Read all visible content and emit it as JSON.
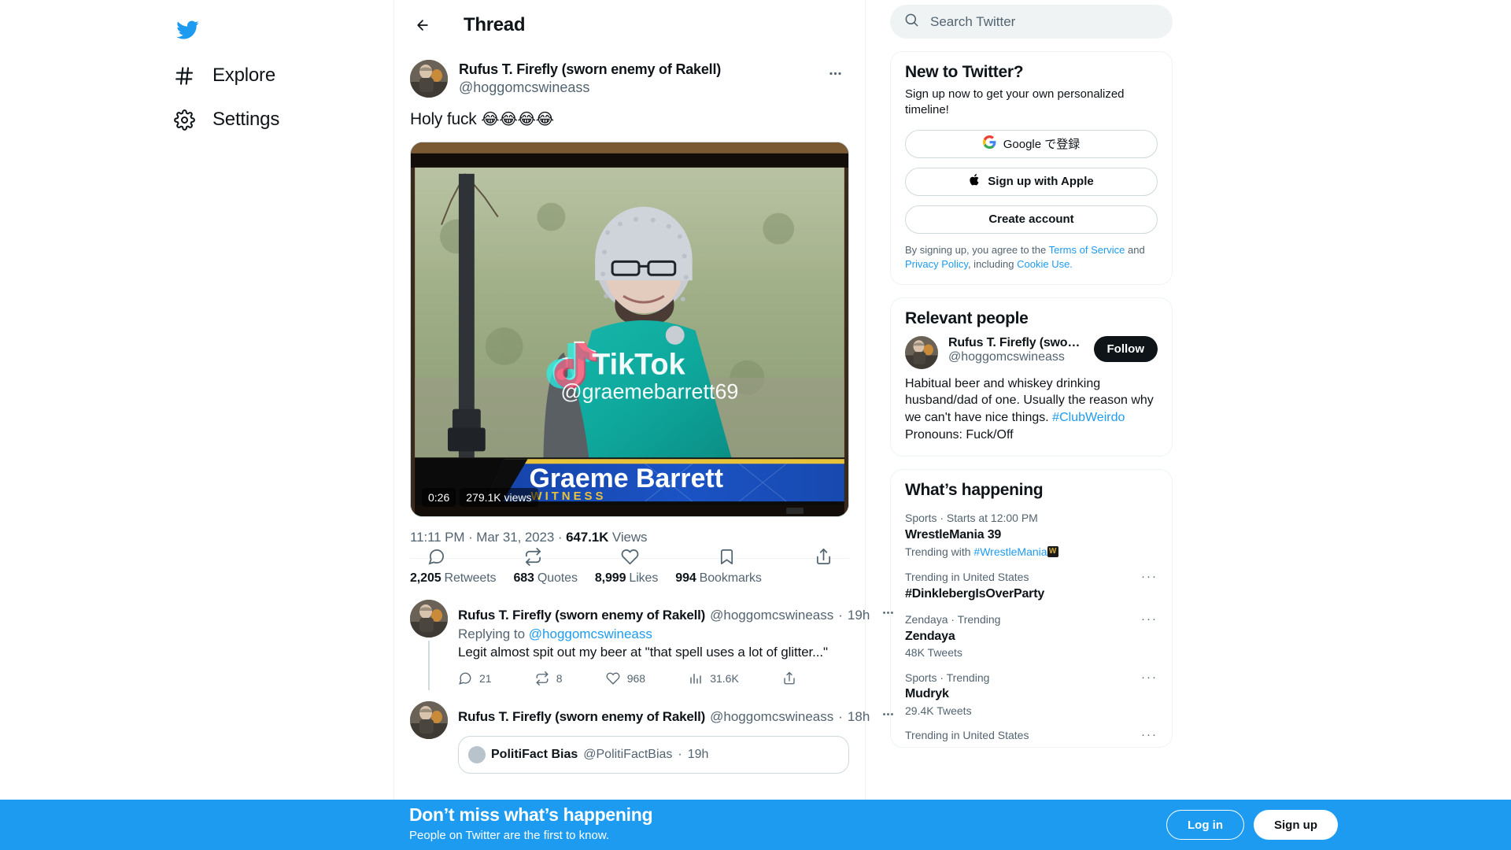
{
  "nav": {
    "logo_icon": "twitter-bird-logo",
    "items": [
      {
        "label": "Explore",
        "icon": "hashtag-icon"
      },
      {
        "label": "Settings",
        "icon": "gear-icon"
      }
    ]
  },
  "header": {
    "title": "Thread",
    "back_icon": "back-arrow-icon"
  },
  "tweet": {
    "author_name": "Rufus T. Firefly (sworn enemy of Rakell)",
    "author_handle": "@hoggomcswineass",
    "more_icon": "more-options-icon",
    "text": "Holy fuck ",
    "emojis": "😂😂😂😂",
    "media": {
      "type": "video",
      "duration": "0:26",
      "views_badge": "279.1K views",
      "watermark_app": "TikTok",
      "watermark_handle": "@graemebarrett69",
      "chyron_name": "Graeme Barrett",
      "chyron_role": "WITNESS"
    },
    "timestamp": "11:11 PM",
    "date": "Mar 31, 2023",
    "views_count": "647.1K",
    "views_label": "Views",
    "counts": [
      {
        "value": "2,205",
        "label": "Retweets"
      },
      {
        "value": "683",
        "label": "Quotes"
      },
      {
        "value": "8,999",
        "label": "Likes"
      },
      {
        "value": "994",
        "label": "Bookmarks"
      }
    ],
    "actions": [
      {
        "icon": "reply-icon"
      },
      {
        "icon": "retweet-icon"
      },
      {
        "icon": "like-heart-icon"
      },
      {
        "icon": "bookmark-icon"
      },
      {
        "icon": "share-icon"
      }
    ]
  },
  "replies": [
    {
      "name": "Rufus T. Firefly (sworn enemy of Rakell)",
      "handle": "@hoggomcswineass",
      "separator": "·",
      "age": "19h",
      "replying_to_label": "Replying to ",
      "replying_to_handle": "@hoggomcswineass",
      "text": "Legit almost spit out my beer at \"that spell uses a lot of glitter...\"",
      "actions": [
        {
          "icon": "reply-icon",
          "count": "21"
        },
        {
          "icon": "retweet-icon",
          "count": "8"
        },
        {
          "icon": "like-heart-icon",
          "count": "968"
        },
        {
          "icon": "views-bars-icon",
          "count": "31.6K"
        },
        {
          "icon": "share-icon",
          "count": ""
        }
      ]
    },
    {
      "name": "Rufus T. Firefly (sworn enemy of Rakell)",
      "handle": "@hoggomcswineass",
      "separator": "·",
      "age": "18h",
      "quote": {
        "name": "PolitiFact Bias",
        "handle": "@PolitiFactBias",
        "separator": "·",
        "age": "19h"
      }
    }
  ],
  "search": {
    "placeholder": "Search Twitter",
    "icon": "search-icon",
    "value": ""
  },
  "signup_card": {
    "title": "New to Twitter?",
    "subtitle": "Sign up now to get your own personalized timeline!",
    "google_label": "Google で登録",
    "google_icon": "google-g-icon",
    "apple_label": "Sign up with Apple",
    "apple_icon": "apple-logo-icon",
    "create_label": "Create account",
    "legal_prefix": "By signing up, you agree to the ",
    "terms": "Terms of Service",
    "legal_and": " and ",
    "privacy": "Privacy Policy",
    "legal_including": ", including ",
    "cookie": "Cookie Use."
  },
  "relevant_people": {
    "title": "Relevant people",
    "person": {
      "name": "Rufus T. Firefly (swor…",
      "handle": "@hoggomcswineass",
      "follow_label": "Follow",
      "bio_part1": "Habitual beer and whiskey drinking husband/dad of one. Usually the reason why we can't have nice things. ",
      "bio_hashtag": "#ClubWeirdo",
      "bio_part2": " Pronouns: Fuck/Off"
    }
  },
  "whats_happening": {
    "title": "What’s happening",
    "trends": [
      {
        "meta": "Sports · Starts at 12:00 PM",
        "name": "WrestleMania 39",
        "trending_with_label": "Trending with ",
        "trending_with_tag": "#WrestleMania",
        "has_emoji": true,
        "count": "",
        "more_icon": ""
      },
      {
        "meta": "Trending in United States",
        "name": "#DinklebergIsOverParty",
        "count": "",
        "more_icon": "more-options-icon"
      },
      {
        "meta": "Zendaya · Trending",
        "name": "Zendaya",
        "count": "48K Tweets",
        "more_icon": "more-options-icon"
      },
      {
        "meta": "Sports · Trending",
        "name": "Mudryk",
        "count": "29.4K Tweets",
        "more_icon": "more-options-icon"
      },
      {
        "meta": "Trending in United States",
        "name": "",
        "count": "",
        "more_icon": "more-options-icon"
      }
    ]
  },
  "bottom_banner": {
    "title": "Don’t miss what’s happening",
    "subtitle": "People on Twitter are the first to know.",
    "login_label": "Log in",
    "signup_label": "Sign up",
    "background": "#1d9bf0"
  },
  "colors": {
    "accent": "#1d9bf0",
    "text": "#0f1419",
    "muted": "#536471",
    "border": "#eff3f4"
  }
}
